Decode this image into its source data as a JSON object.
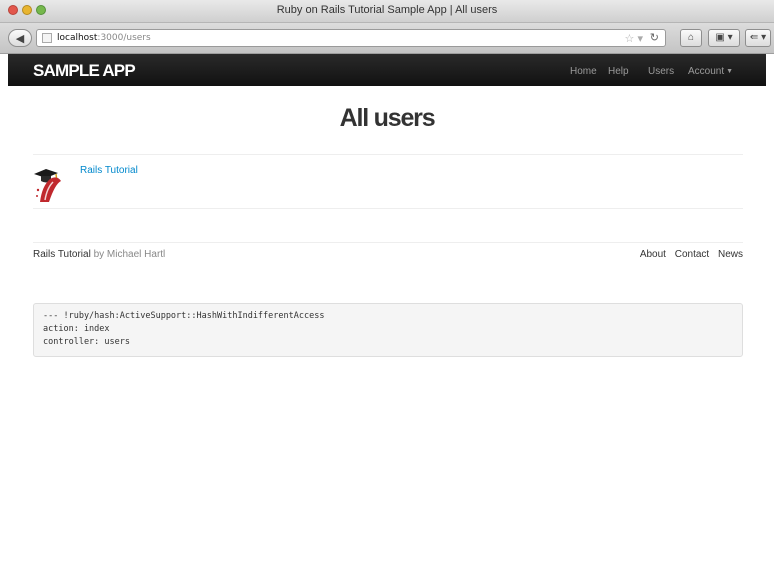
{
  "window": {
    "title": "Ruby on Rails Tutorial Sample App | All users"
  },
  "urlbar": {
    "host": "localhost",
    "path": ":3000/users"
  },
  "navbar": {
    "logo": "SAMPLE APP",
    "links": [
      "Home",
      "Help",
      "Users",
      "Account"
    ]
  },
  "page": {
    "title": "All users"
  },
  "users": [
    {
      "name": "Rails Tutorial"
    }
  ],
  "footer": {
    "brand": "Rails Tutorial",
    "by": "by Michael Hartl",
    "links": [
      "About",
      "Contact",
      "News"
    ]
  },
  "debug": {
    "lines": [
      "--- !ruby/hash:ActiveSupport::HashWithIndifferentAccess",
      "action: index",
      "controller: users"
    ]
  },
  "colors": {
    "navbar": "#1b1b1b",
    "link": "#0088cc",
    "nav_link": "#9a9a9a"
  },
  "icons": {
    "back": "left-arrow",
    "bookmark": "star",
    "reload": "reload",
    "home": "house",
    "gravatar": "rails-tutorial-avatar"
  }
}
